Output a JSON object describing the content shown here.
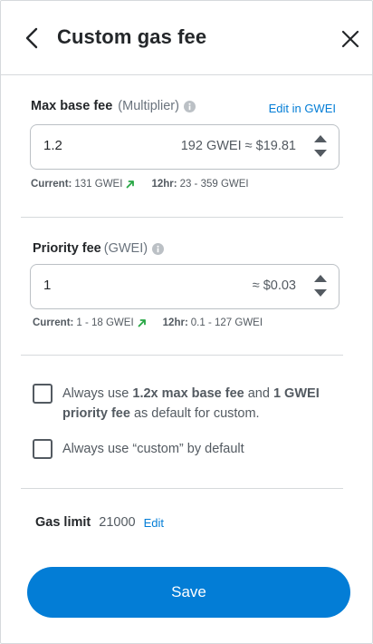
{
  "header": {
    "title": "Custom gas fee"
  },
  "max_base_fee": {
    "label": "Max base fee",
    "unit": "(Multiplier)",
    "edit_link": "Edit in GWEI",
    "value": "1.2",
    "conversion": "192 GWEI ≈ $19.81",
    "current_label": "Current:",
    "current_value": "131 GWEI",
    "range_label": "12hr:",
    "range_value": "23 - 359 GWEI"
  },
  "priority_fee": {
    "label": "Priority fee",
    "unit": "(GWEI)",
    "value": "1",
    "conversion": "≈ $0.03",
    "current_label": "Current:",
    "current_value": "1 - 18 GWEI",
    "range_label": "12hr:",
    "range_value": "0.1 - 127 GWEI"
  },
  "options": {
    "default_custom": {
      "pre": "Always use ",
      "b1": "1.2x max base fee",
      "mid": " and ",
      "b2": "1 GWEI priority fee",
      "post": " as default for custom.",
      "checked": false
    },
    "always_custom": {
      "label": "Always use “custom” by default",
      "checked": false
    }
  },
  "gas_limit": {
    "label": "Gas limit",
    "value": "21000",
    "edit_link": "Edit"
  },
  "save_label": "Save",
  "colors": {
    "accent": "#037dd6",
    "trend_up": "#28a745",
    "text": "#24272a",
    "muted": "#535a61",
    "border": "#bbc0c5"
  },
  "icons": {
    "back": "chevron-left-icon",
    "close": "close-icon",
    "info": "info-icon",
    "trend": "trend-up-arrow-icon",
    "stepper_up": "caret-up-icon",
    "stepper_down": "caret-down-icon"
  }
}
